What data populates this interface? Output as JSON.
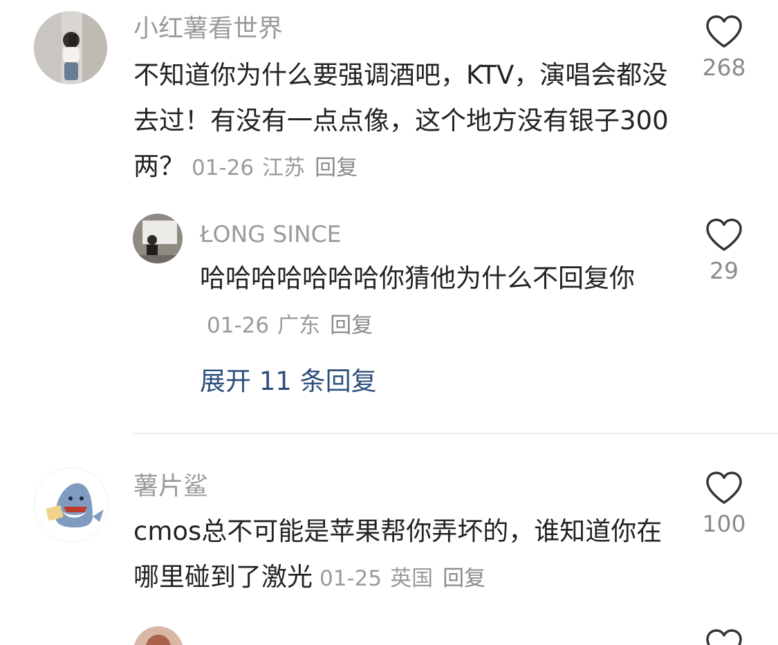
{
  "comments": [
    {
      "username": "小红薯看世界",
      "text": "不知道你为什么要强调酒吧，KTV，演唱会都没去过！有没有一点点像，这个地方没有银子300两？",
      "date": "01-26",
      "region": "江苏",
      "reply_label": "回复",
      "likes": "268",
      "avatar_icon": "user-avatar-photo"
    },
    {
      "username": "ŁONG SINCE",
      "text": "哈哈哈哈哈哈哈你猜他为什么不回复你",
      "date": "01-26",
      "region": "广东",
      "reply_label": "回复",
      "likes": "29",
      "avatar_icon": "user-avatar-photo"
    },
    {
      "username": "薯片鲨",
      "text": "cmos总不可能是苹果帮你弄坏的，谁知道你在哪里碰到了激光",
      "date": "01-25",
      "region": "英国",
      "reply_label": "回复",
      "likes": "100",
      "avatar_icon": "shark-avatar"
    }
  ],
  "expand_replies": "展开 11 条回复",
  "colors": {
    "text": "#222222",
    "meta": "#9a9a9a",
    "link": "#2d4f7c",
    "divider": "#efefef"
  }
}
